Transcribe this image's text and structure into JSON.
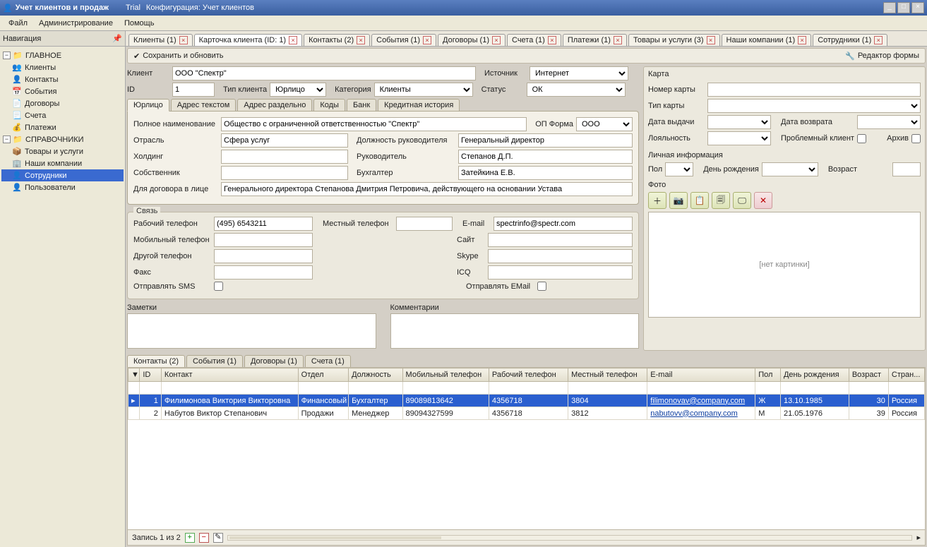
{
  "title": {
    "app": "Учет клиентов и продаж",
    "trial": "Trial",
    "config": "Конфигурация: Учет клиентов"
  },
  "menu": {
    "file": "Файл",
    "admin": "Администрирование",
    "help": "Помощь"
  },
  "nav": {
    "label": "Навигация",
    "main": "ГЛАВНОЕ",
    "refs": "СПРАВОЧНИКИ",
    "main_items": [
      "Клиенты",
      "Контакты",
      "События",
      "Договоры",
      "Счета",
      "Платежи"
    ],
    "ref_items": [
      "Товары и услуги",
      "Наши компании",
      "Сотрудники",
      "Пользователи"
    ]
  },
  "tabs": [
    "Клиенты (1)",
    "Карточка клиента (ID: 1)",
    "Контакты (2)",
    "События (1)",
    "Договоры (1)",
    "Счета (1)",
    "Платежи (1)",
    "Товары и услуги (3)",
    "Наши компании (1)",
    "Сотрудники (1)"
  ],
  "toolbar": {
    "save": "Сохранить и обновить",
    "editor": "Редактор формы"
  },
  "form": {
    "client_lbl": "Клиент",
    "client": "ООО \"Спектр\"",
    "source_lbl": "Источник",
    "source": "Интернет",
    "id_lbl": "ID",
    "id": "1",
    "ctype_lbl": "Тип клиента",
    "ctype": "Юрлицо",
    "cat_lbl": "Категория",
    "cat": "Клиенты",
    "status_lbl": "Статус",
    "status": "ОК"
  },
  "subtabs": [
    "Юрлицо",
    "Адрес текстом",
    "Адрес раздельно",
    "Коды",
    "Банк",
    "Кредитная история"
  ],
  "legal": {
    "fullname_lbl": "Полное наименование",
    "fullname": "Общество с ограниченной ответственностью \"Спектр\"",
    "opf_lbl": "ОП Форма",
    "opf": "ООО",
    "industry_lbl": "Отрасль",
    "industry": "Сфера услуг",
    "dirpos_lbl": "Должность руководителя",
    "dirpos": "Генеральный директор",
    "holding_lbl": "Холдинг",
    "director_lbl": "Руководитель",
    "director": "Степанов Д.П.",
    "owner_lbl": "Собственник",
    "accountant_lbl": "Бухгалтер",
    "accountant": "Затейкина Е.В.",
    "inlaw_lbl": "Для договора в лице",
    "inlaw": "Генерального директора Степанова Дмитрия Петровича, действующего на основании Устава"
  },
  "contact": {
    "title": "Связь",
    "wphone_lbl": "Рабочий телефон",
    "wphone": "(495) 6543211",
    "lphone_lbl": "Местный телефон",
    "email_lbl": "E-mail",
    "email": "spectrinfo@spectr.com",
    "mphone_lbl": "Мобильный телефон",
    "site_lbl": "Сайт",
    "ophone_lbl": "Другой телефон",
    "skype_lbl": "Skype",
    "fax_lbl": "Факс",
    "icq_lbl": "ICQ",
    "sms_lbl": "Отправлять SMS",
    "semail_lbl": "Отправлять EMail"
  },
  "notes": {
    "notes_lbl": "Заметки",
    "comments_lbl": "Комментарии"
  },
  "card": {
    "title": "Карта",
    "num_lbl": "Номер карты",
    "type_lbl": "Тип карты",
    "issue_lbl": "Дата выдачи",
    "return_lbl": "Дата возврата",
    "loyal_lbl": "Лояльность",
    "problem_lbl": "Проблемный клиент",
    "archive_lbl": "Архив",
    "personal": "Личная информация",
    "sex_lbl": "Пол",
    "bday_lbl": "День рождения",
    "age_lbl": "Возраст",
    "photo_lbl": "Фото",
    "nophoto": "[нет картинки]"
  },
  "btabs": [
    "Контакты (2)",
    "События (1)",
    "Договоры (1)",
    "Счета (1)"
  ],
  "grid": {
    "cols": [
      "ID",
      "Контакт",
      "Отдел",
      "Должность",
      "Мобильный телефон",
      "Рабочий телефон",
      "Местный телефон",
      "E-mail",
      "Пол",
      "День рождения",
      "Возраст",
      "Стран..."
    ],
    "rows": [
      {
        "id": "1",
        "name": "Филимонова Виктория Викторовна",
        "dept": "Финансовый",
        "pos": "Бухгалтер",
        "mob": "89089813642",
        "work": "4356718",
        "loc": "3804",
        "email": "filimonovav@company.com",
        "sex": "Ж",
        "bday": "13.10.1985",
        "age": "30",
        "country": "Россия"
      },
      {
        "id": "2",
        "name": "Набутов Виктор Степанович",
        "dept": "Продажи",
        "pos": "Менеджер",
        "mob": "89094327599",
        "work": "4356718",
        "loc": "3812",
        "email": "nabutovv@company.com",
        "sex": "М",
        "bday": "21.05.1976",
        "age": "39",
        "country": "Россия"
      }
    ],
    "footer": "Запись 1 из 2"
  }
}
